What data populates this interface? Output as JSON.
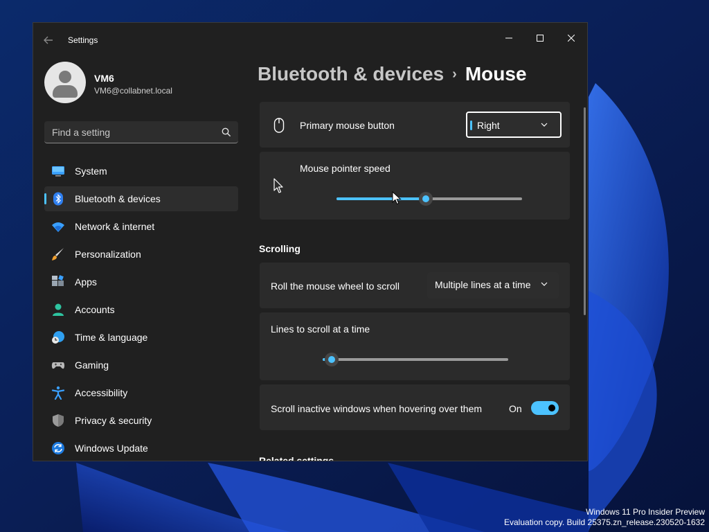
{
  "window": {
    "title": "Settings",
    "controls": {
      "minimize": "minimize",
      "maximize": "maximize",
      "close": "close"
    }
  },
  "user": {
    "name": "VM6",
    "email": "VM6@collabnet.local"
  },
  "search": {
    "placeholder": "Find a setting"
  },
  "nav": [
    {
      "label": "System",
      "icon": "system-icon",
      "active": false
    },
    {
      "label": "Bluetooth & devices",
      "icon": "bluetooth-icon",
      "active": true
    },
    {
      "label": "Network & internet",
      "icon": "wifi-icon",
      "active": false
    },
    {
      "label": "Personalization",
      "icon": "brush-icon",
      "active": false
    },
    {
      "label": "Apps",
      "icon": "apps-icon",
      "active": false
    },
    {
      "label": "Accounts",
      "icon": "accounts-icon",
      "active": false
    },
    {
      "label": "Time & language",
      "icon": "globe-clock-icon",
      "active": false
    },
    {
      "label": "Gaming",
      "icon": "gamepad-icon",
      "active": false
    },
    {
      "label": "Accessibility",
      "icon": "accessibility-icon",
      "active": false
    },
    {
      "label": "Privacy & security",
      "icon": "shield-icon",
      "active": false
    },
    {
      "label": "Windows Update",
      "icon": "update-icon",
      "active": false
    }
  ],
  "breadcrumb": {
    "parent": "Bluetooth & devices",
    "separator": "›",
    "current": "Mouse"
  },
  "primary_button": {
    "label": "Primary mouse button",
    "value": "Right"
  },
  "pointer_speed": {
    "label": "Mouse pointer speed",
    "level": 0.48
  },
  "scrolling": {
    "header": "Scrolling",
    "wheel": {
      "label": "Roll the mouse wheel to scroll",
      "value": "Multiple lines at a time"
    },
    "lines": {
      "label": "Lines to scroll at a time",
      "level": 0.05
    },
    "inactive": {
      "label": "Scroll inactive windows when hovering over them",
      "state": "On",
      "on": true
    }
  },
  "related": {
    "header": "Related settings"
  },
  "watermark": {
    "line1": "Windows 11 Pro Insider Preview",
    "line2": "Evaluation copy. Build 25375.zn_release.230520-1632"
  },
  "colors": {
    "accent": "#4cc2ff",
    "window_bg": "#202020",
    "card_bg": "#2b2b2b"
  }
}
